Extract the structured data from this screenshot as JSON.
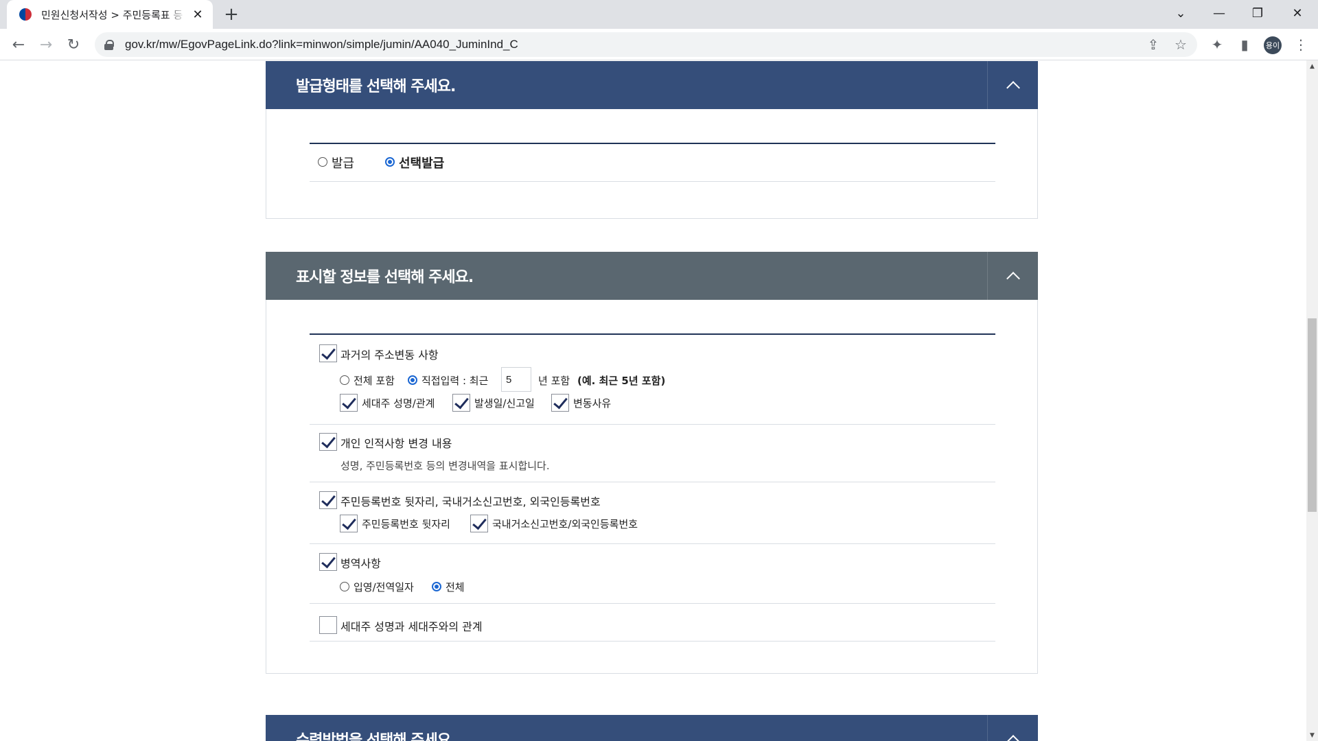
{
  "browser": {
    "tab_title": "민원신청서작성 > 주민등록표 등",
    "url": "gov.kr/mw/EgovPageLink.do?link=minwon/simple/jumin/AA040_JuminInd_C",
    "profile_initials": "용이"
  },
  "section_issue": {
    "title": "발급형태를 선택해 주세요.",
    "options": [
      {
        "label": "발급",
        "selected": false
      },
      {
        "label": "선택발급",
        "selected": true
      }
    ]
  },
  "section_display": {
    "title": "표시할 정보를 선택해 주세요.",
    "address_history": {
      "label": "과거의 주소변동 사항",
      "checked": true,
      "radio_all": {
        "label": "전체 포함",
        "selected": false
      },
      "radio_direct": {
        "label": "직접입력 : 최근",
        "selected": true
      },
      "years_value": "5",
      "years_suffix": "년 포함",
      "example": "(예. 최근 5년 포함)",
      "sub_checks": [
        {
          "label": "세대주 성명/관계",
          "checked": true
        },
        {
          "label": "발생일/신고일",
          "checked": true
        },
        {
          "label": "변동사유",
          "checked": true
        }
      ]
    },
    "personal_changes": {
      "label": "개인 인적사항 변경 내용",
      "checked": true,
      "desc": "성명, 주민등록번호 등의 변경내역을 표시합니다."
    },
    "id_numbers": {
      "label": "주민등록번호 뒷자리, 국내거소신고번호, 외국인등록번호",
      "checked": true,
      "sub_checks": [
        {
          "label": "주민등록번호 뒷자리",
          "checked": true
        },
        {
          "label": "국내거소신고번호/외국인등록번호",
          "checked": true
        }
      ]
    },
    "military": {
      "label": "병역사항",
      "checked": true,
      "radio_dates": {
        "label": "입영/전역일자",
        "selected": false
      },
      "radio_all": {
        "label": "전체",
        "selected": true
      }
    },
    "householder": {
      "label": "세대주 성명과 세대주와의 관계",
      "checked": false
    }
  },
  "section_receive": {
    "title": "수령방법을 선택해 주세요."
  }
}
